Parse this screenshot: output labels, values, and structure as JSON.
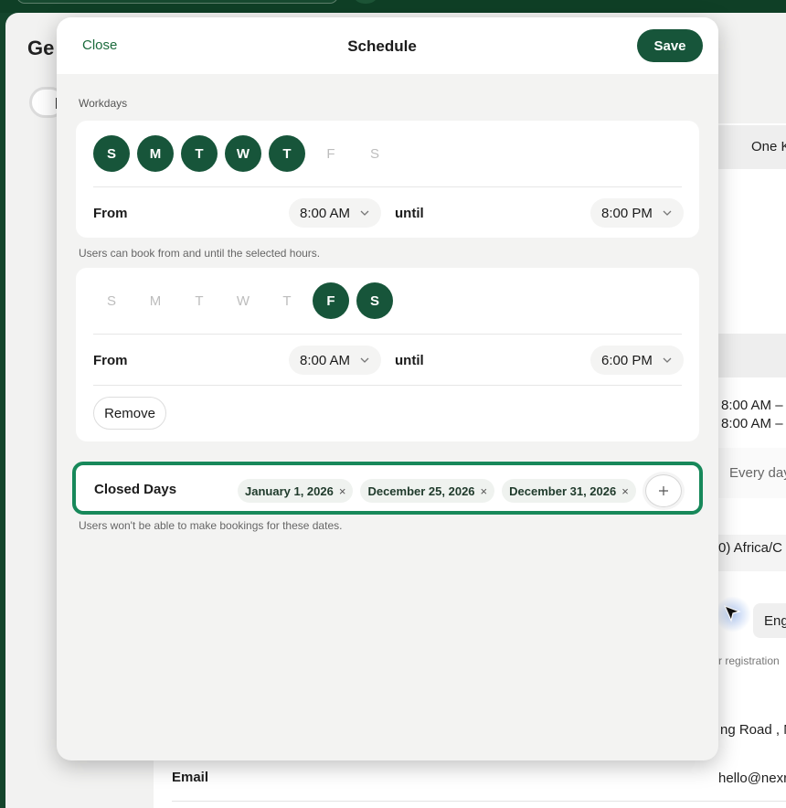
{
  "background": {
    "page_title": "Ge",
    "rows": {
      "item1": "One K",
      "hours1": "8:00 AM –",
      "hours2": "8:00 AM –",
      "every_day": "Every day",
      "timezone": "0) Africa/C",
      "language": "Eng",
      "registration_note": "r registration",
      "address": "ng Road , N",
      "email_label": "Email",
      "email_value": "hello@nexr"
    }
  },
  "modal": {
    "close_label": "Close",
    "title": "Schedule",
    "save_label": "Save",
    "workdays_label": "Workdays",
    "schedule1": {
      "days": [
        {
          "letter": "S",
          "on": true
        },
        {
          "letter": "M",
          "on": true
        },
        {
          "letter": "T",
          "on": true
        },
        {
          "letter": "W",
          "on": true
        },
        {
          "letter": "T",
          "on": true
        },
        {
          "letter": "F",
          "on": false
        },
        {
          "letter": "S",
          "on": false
        }
      ],
      "from_label": "From",
      "from_value": "8:00 AM",
      "until_label": "until",
      "until_value": "8:00 PM"
    },
    "hours_helper": "Users can book from and until the selected hours.",
    "schedule2": {
      "days": [
        {
          "letter": "S",
          "on": false
        },
        {
          "letter": "M",
          "on": false
        },
        {
          "letter": "T",
          "on": false
        },
        {
          "letter": "W",
          "on": false
        },
        {
          "letter": "T",
          "on": false
        },
        {
          "letter": "F",
          "on": true
        },
        {
          "letter": "S",
          "on": true
        }
      ],
      "from_label": "From",
      "from_value": "8:00 AM",
      "until_label": "until",
      "until_value": "6:00 PM",
      "remove_label": "Remove"
    },
    "closed_days": {
      "label": "Closed Days",
      "dates": [
        "January 1, 2026",
        "December 25, 2026",
        "December 31, 2026"
      ],
      "remove_glyph": "×",
      "add_glyph": "+",
      "helper": "Users won't be able to make bookings for these dates."
    }
  },
  "colors": {
    "accent": "#17553a",
    "highlight_border": "#17885a"
  }
}
